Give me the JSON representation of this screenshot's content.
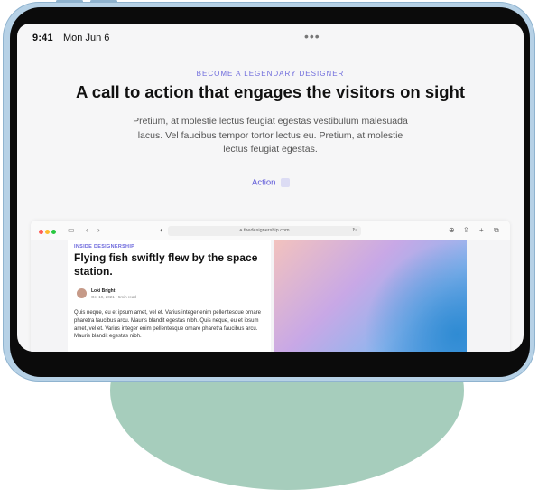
{
  "status_bar": {
    "time": "9:41",
    "date": "Mon Jun 6",
    "more": "•••"
  },
  "hero": {
    "eyebrow": "BECOME A LEGENDARY DESIGNER",
    "headline": "A call to action that engages the visitors on sight",
    "body": "Pretium, at molestie lectus feugiat egestas vestibulum malesuada lacus. Vel faucibus tempor tortor lectus eu. Pretium, at molestie lectus feugiat egestas.",
    "action_label": "Action"
  },
  "browser": {
    "url": "thedesignership.com",
    "article": {
      "kicker": "INSIDE DESIGNERSHIP",
      "title": "Flying fish swiftly flew by the space station.",
      "author": "Loki Bright",
      "meta": "Oct 19, 2021 • 5min read",
      "excerpt": "Quis neque, eu et ipsum amet, vel et. Varius integer enim pellentesque ornare pharetra faucibus arcu. Mauris blandit egestas nibh. Quis neque, eu et ipsum amet, vel et. Varius integer enim pellentesque ornare pharetra faucibus arcu. Mauris blandit egestas nibh."
    }
  },
  "colors": {
    "accent": "#5b56d8",
    "device_frame": "#b6d1e6",
    "blob": "#a6cdbc"
  },
  "icons": [
    "sidebar-icon",
    "back-icon",
    "forward-icon",
    "shield-icon",
    "lock-icon",
    "reload-icon",
    "download-icon",
    "share-icon",
    "new-tab-icon",
    "tabs-icon"
  ]
}
